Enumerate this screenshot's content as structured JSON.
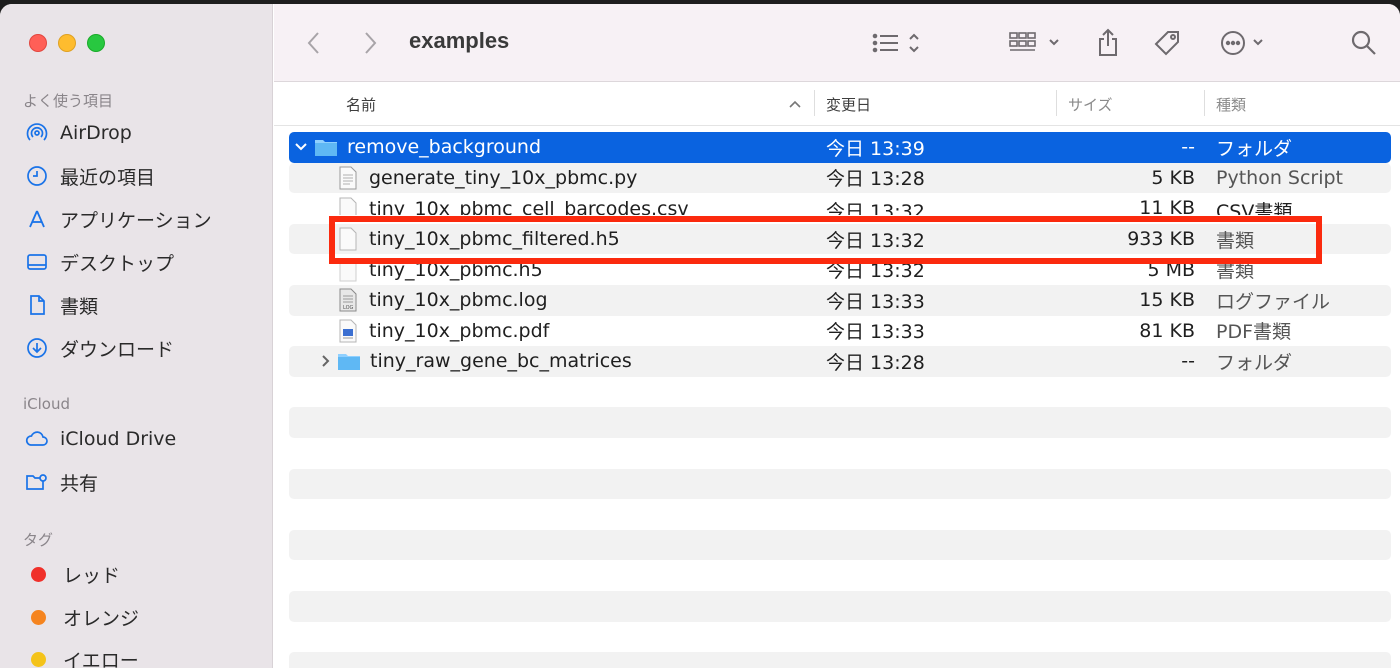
{
  "window": {
    "title": "examples"
  },
  "sidebar": {
    "favorites_header": "よく使う項目",
    "favorites": [
      {
        "label": "AirDrop",
        "icon": "airdrop-icon"
      },
      {
        "label": "最近の項目",
        "icon": "clock-icon"
      },
      {
        "label": "アプリケーション",
        "icon": "applications-icon"
      },
      {
        "label": "デスクトップ",
        "icon": "desktop-icon"
      },
      {
        "label": "書類",
        "icon": "document-icon"
      },
      {
        "label": "ダウンロード",
        "icon": "download-icon"
      }
    ],
    "icloud_header": "iCloud",
    "icloud": [
      {
        "label": "iCloud Drive",
        "icon": "cloud-icon"
      },
      {
        "label": "共有",
        "icon": "shared-folder-icon"
      }
    ],
    "tags_header": "タグ",
    "tags": [
      {
        "label": "レッド",
        "color": "#f0302a"
      },
      {
        "label": "オレンジ",
        "color": "#f5841f"
      },
      {
        "label": "イエロー",
        "color": "#f4c31a"
      }
    ]
  },
  "columns": {
    "name": "名前",
    "date": "変更日",
    "size": "サイズ",
    "kind": "種類"
  },
  "rows": [
    {
      "name": "remove_background",
      "date": "今日 13:39",
      "size": "--",
      "kind": "フォルダ",
      "icon": "folder-icon",
      "expanded": true
    },
    {
      "name": "generate_tiny_10x_pbmc.py",
      "date": "今日 13:28",
      "size": "5 KB",
      "kind": "Python Script",
      "icon": "script-file-icon"
    },
    {
      "name": "tiny_10x_pbmc_cell_barcodes.csv",
      "date": "今日 13:32",
      "size": "11 KB",
      "kind": "CSV書類",
      "icon": "file-icon"
    },
    {
      "name": "tiny_10x_pbmc_filtered.h5",
      "date": "今日 13:32",
      "size": "933 KB",
      "kind": "書類",
      "icon": "file-icon"
    },
    {
      "name": "tiny_10x_pbmc.h5",
      "date": "今日 13:32",
      "size": "5 MB",
      "kind": "書類",
      "icon": "file-icon"
    },
    {
      "name": "tiny_10x_pbmc.log",
      "date": "今日 13:33",
      "size": "15 KB",
      "kind": "ログファイル",
      "icon": "log-file-icon"
    },
    {
      "name": "tiny_10x_pbmc.pdf",
      "date": "今日 13:33",
      "size": "81 KB",
      "kind": "PDF書類",
      "icon": "pdf-file-icon"
    },
    {
      "name": "tiny_raw_gene_bc_matrices",
      "date": "今日 13:28",
      "size": "--",
      "kind": "フォルダ",
      "icon": "folder-icon",
      "expanded": false
    }
  ],
  "colors": {
    "selection": "#0a63e0",
    "highlight_box": "#fb2a0e",
    "folder": "#5fb8f4"
  }
}
